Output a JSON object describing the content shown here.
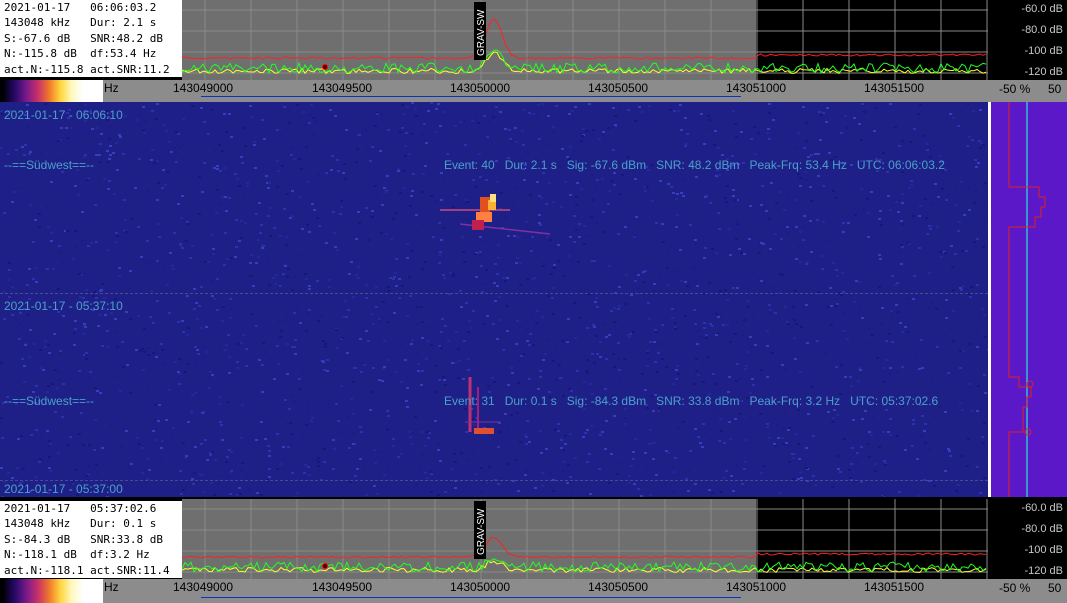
{
  "top_info": {
    "row1": "2021-01-17   06:06:03.2",
    "row2": "143048 kHz   Dur: 2.1 s",
    "row3": "S:-67.6 dB   SNR:48.2 dB",
    "row4": "N:-115.8 dB  df:53.4 Hz",
    "row5": "act.N:-115.8 act.SNR:11.2"
  },
  "bottom_info": {
    "row1": "2021-01-17   05:37:02.6",
    "row2": "143048 kHz   Dur: 0.1 s",
    "row3": "S:-84.3 dB   SNR:33.8 dB",
    "row4": "N:-118.1 dB  df:3.2 Hz",
    "row5": "act.N:-118.1 act.SNR:11.4"
  },
  "db_scale": [
    "-60.0 dB",
    "-80.0 dB",
    "-100 dB",
    "-120 dB"
  ],
  "freq_axis": {
    "unit_label": "Hz",
    "ticks": [
      "143049000",
      "143049500",
      "143050000",
      "143050500",
      "143051000",
      "143051500"
    ]
  },
  "marker_label": "GRAV-SW",
  "percent_bar": {
    "left": "-50 %",
    "right": "50"
  },
  "waterfall": {
    "times": [
      "2021-01-17 - 06:06:10",
      "2021-01-17 - 05:37:10",
      "2021-01-17 - 05:37:00"
    ],
    "events": [
      {
        "station": "--==Südwest==--",
        "info": "Event: 40   Dur: 2.1 s   Sig: -67.6 dBm   SNR: 48.2 dBm   Peak-Frq: 53.4 Hz   UTC: 06:06:03.2"
      },
      {
        "station": "--==Südwest==--",
        "info": "Event: 31   Dur: 0.1 s   Sig: -84.3 dBm   SNR: 33.8 dBm   Peak-Frq: 3.2 Hz   UTC: 05:37:02.6"
      }
    ]
  },
  "colors": {
    "waterfall_bg": "#1e2088",
    "spectrum_bg": "#6f6f6f",
    "trace_green": "#20ff20",
    "trace_red": "#ff2020",
    "trace_yellow": "#ffff30",
    "histogram_bg": "#5a18c8"
  }
}
